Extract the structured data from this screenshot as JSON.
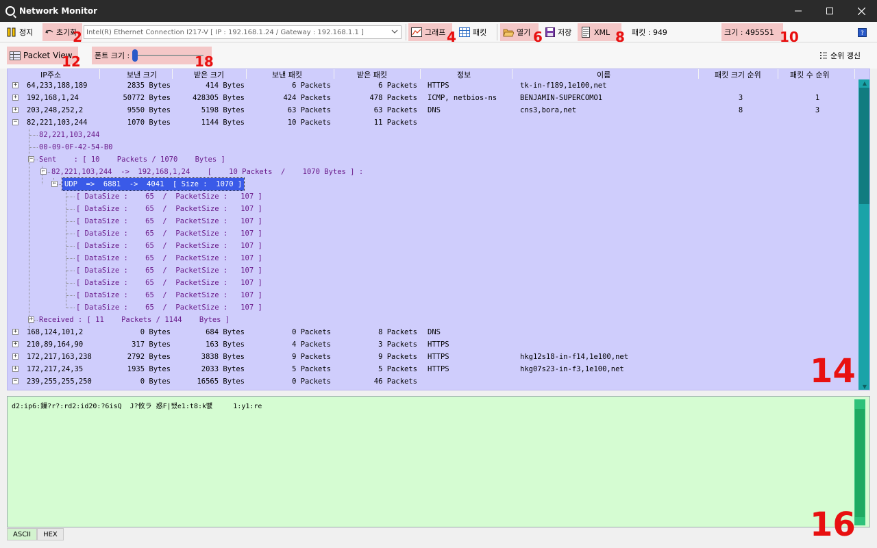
{
  "window": {
    "title": "Network Monitor",
    "controls": [
      "minimize-icon",
      "maximize-icon",
      "close-icon"
    ]
  },
  "toolbar": {
    "stop_label": "정지",
    "reset_label": "초기화",
    "adapter_selected": "Intel(R) Ethernet Connection I217-V    [ IP : 192.168.1.24 / Gateway : 192.168.1.1 ]",
    "graph_label": "그래프",
    "packet_label": "패킷",
    "open_label": "열기",
    "save_label": "저장",
    "xml_label": "XML",
    "packet_count_text": "패킷  : 949",
    "size_text": "크기 : 495551",
    "help_icon": "help-icon"
  },
  "subbar": {
    "packet_view_label": "Packet View",
    "font_size_label": "폰트 크기 :",
    "font_size_slider_value": 0.0,
    "refresh_rank_label": "순위 갱신"
  },
  "annotations": [
    "2",
    "4",
    "6",
    "8",
    "10",
    "12",
    "14",
    "16",
    "18"
  ],
  "columns": [
    "IP주소",
    "보낸 크기",
    "받은 크기",
    "보낸 패킷",
    "받은 패킷",
    "정보",
    "이름",
    "패킷 크기 순위",
    "패킷 수 순위"
  ],
  "rows_top": [
    {
      "ip": "64,233,188,189",
      "sent": "2835 Bytes",
      "recv": "414 Bytes",
      "sp": "6 Packets",
      "rp": "6 Packets",
      "info": "HTTPS",
      "name": "tk-in-f189,1e100,net",
      "srank": "",
      "crank": ""
    },
    {
      "ip": "192,168,1,24",
      "sent": "50772 Bytes",
      "recv": "428305 Bytes",
      "sp": "424 Packets",
      "rp": "478 Packets",
      "info": "ICMP, netbios-ns",
      "name": "BENJAMIN-SUPERCOMO1",
      "srank": "3",
      "crank": "1"
    },
    {
      "ip": "203,248,252,2",
      "sent": "9550 Bytes",
      "recv": "5198 Bytes",
      "sp": "63 Packets",
      "rp": "63 Packets",
      "info": "DNS",
      "name": "cns3,bora,net",
      "srank": "8",
      "crank": "3"
    },
    {
      "ip": "82,221,103,244",
      "sent": "1070 Bytes",
      "recv": "1144 Bytes",
      "sp": "10 Packets",
      "rp": "11 Packets",
      "info": "",
      "name": "",
      "srank": "",
      "crank": ""
    }
  ],
  "expanded": {
    "child_ip": "82,221,103,244",
    "mac": "00-09-0F-42-54-B0",
    "sent_node": "Sent    : [ 10    Packets / 1070    Bytes ]",
    "flow_node": "82,221,103,244  ->  192,168,1,24    [    10 Packets  /    1070 Bytes ] :",
    "udp_node": "UDP  =>  6881  ->  4041  [ Size :  1070 ]",
    "data_rows": [
      "[ DataSize :    65  /  PacketSize :   107 ]",
      "[ DataSize :    65  /  PacketSize :   107 ]",
      "[ DataSize :    65  /  PacketSize :   107 ]",
      "[ DataSize :    65  /  PacketSize :   107 ]",
      "[ DataSize :    65  /  PacketSize :   107 ]",
      "[ DataSize :    65  /  PacketSize :   107 ]",
      "[ DataSize :    65  /  PacketSize :   107 ]",
      "[ DataSize :    65  /  PacketSize :   107 ]",
      "[ DataSize :    65  /  PacketSize :   107 ]",
      "[ DataSize :    65  /  PacketSize :   107 ]"
    ],
    "received_node": "Received : [ 11    Packets / 1144    Bytes ]"
  },
  "rows_bottom": [
    {
      "ip": "168,124,101,2",
      "sent": "0 Bytes",
      "recv": "684 Bytes",
      "sp": "0 Packets",
      "rp": "8 Packets",
      "info": "DNS",
      "name": "",
      "srank": "",
      "crank": ""
    },
    {
      "ip": "210,89,164,90",
      "sent": "317 Bytes",
      "recv": "163 Bytes",
      "sp": "4 Packets",
      "rp": "3 Packets",
      "info": "HTTPS",
      "name": "",
      "srank": "",
      "crank": ""
    },
    {
      "ip": "172,217,163,238",
      "sent": "2792 Bytes",
      "recv": "3838 Bytes",
      "sp": "9 Packets",
      "rp": "9 Packets",
      "info": "HTTPS",
      "name": "hkg12s18-in-f14,1e100,net",
      "srank": "",
      "crank": ""
    },
    {
      "ip": "172,217,24,35",
      "sent": "1935 Bytes",
      "recv": "2033 Bytes",
      "sp": "5 Packets",
      "rp": "5 Packets",
      "info": "HTTPS",
      "name": "hkg07s23-in-f3,1e100,net",
      "srank": "",
      "crank": ""
    },
    {
      "ip": "239,255,255,250",
      "sent": "0 Bytes",
      "recv": "16565 Bytes",
      "sp": "0 Packets",
      "rp": "46 Packets",
      "info": "",
      "name": "",
      "srank": "",
      "crank": ""
    }
  ],
  "partial_row": "239,255,255,250",
  "hex_panel": {
    "content": "d2:ip6:鏁?r?:rd2:id20:?6isQ  J?攸ラ 惑F|됐e1:t8:k뻀     1:y1:re",
    "tabs": [
      "ASCII",
      "HEX"
    ],
    "active_tab": "ASCII"
  },
  "colors": {
    "tree_bg": "#cfcdfc",
    "hex_bg": "#d5fcd2",
    "highlight": "#f4c7c7",
    "annotation": "#e81010",
    "selection": "#3a5ae8"
  }
}
